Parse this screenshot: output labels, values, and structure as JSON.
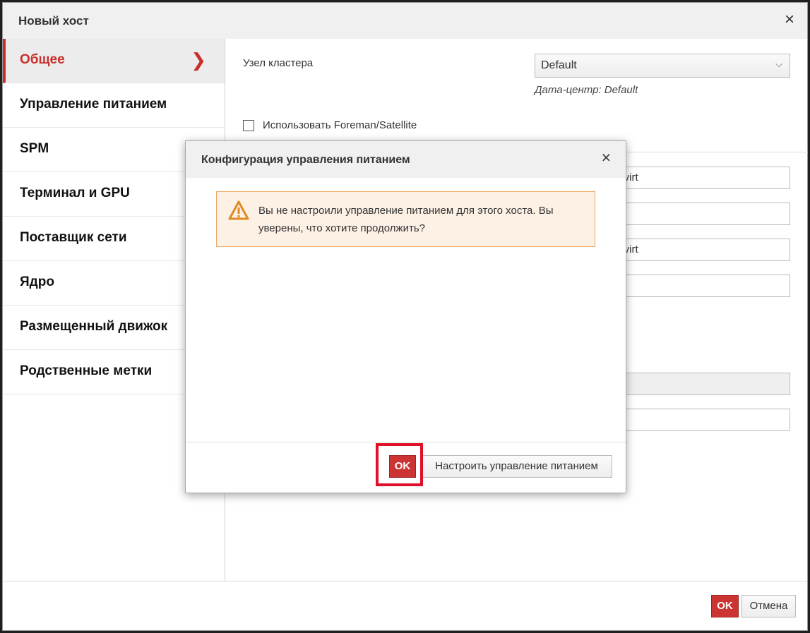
{
  "outer_dialog": {
    "title": "Новый хост",
    "close_symbol": "×",
    "sidebar": [
      {
        "label": "Общее",
        "active": true
      },
      {
        "label": "Управление питанием"
      },
      {
        "label": "SPM"
      },
      {
        "label": "Терминал и GPU"
      },
      {
        "label": "Поставщик сети"
      },
      {
        "label": "Ядро"
      },
      {
        "label": "Размещенный движок"
      },
      {
        "label": "Родственные метки"
      }
    ],
    "general": {
      "cluster_label": "Узел кластера",
      "cluster_value": "Default",
      "datacenter_text": "Дата-центр: Default",
      "foreman_label": "Использовать Foreman/Satellite",
      "field_values": [
        "edvirt",
        "",
        "edvirt",
        "",
        "",
        ""
      ]
    },
    "footer": {
      "ok_label": "OK",
      "cancel_label": "Отмена"
    }
  },
  "inner_dialog": {
    "title": "Конфигурация управления питанием",
    "close_symbol": "×",
    "warning_icon": "warning-triangle-icon",
    "warning_text": "Вы не настроили управление питанием для этого хоста. Вы уверены, что хотите продолжить?",
    "ok_label": "OK",
    "configure_label": "Настроить управление питанием"
  },
  "colors": {
    "accent": "#cc3333",
    "warning_bg": "#fdf1e5",
    "warning_border": "#e8a865",
    "highlight": "#e0102a"
  }
}
